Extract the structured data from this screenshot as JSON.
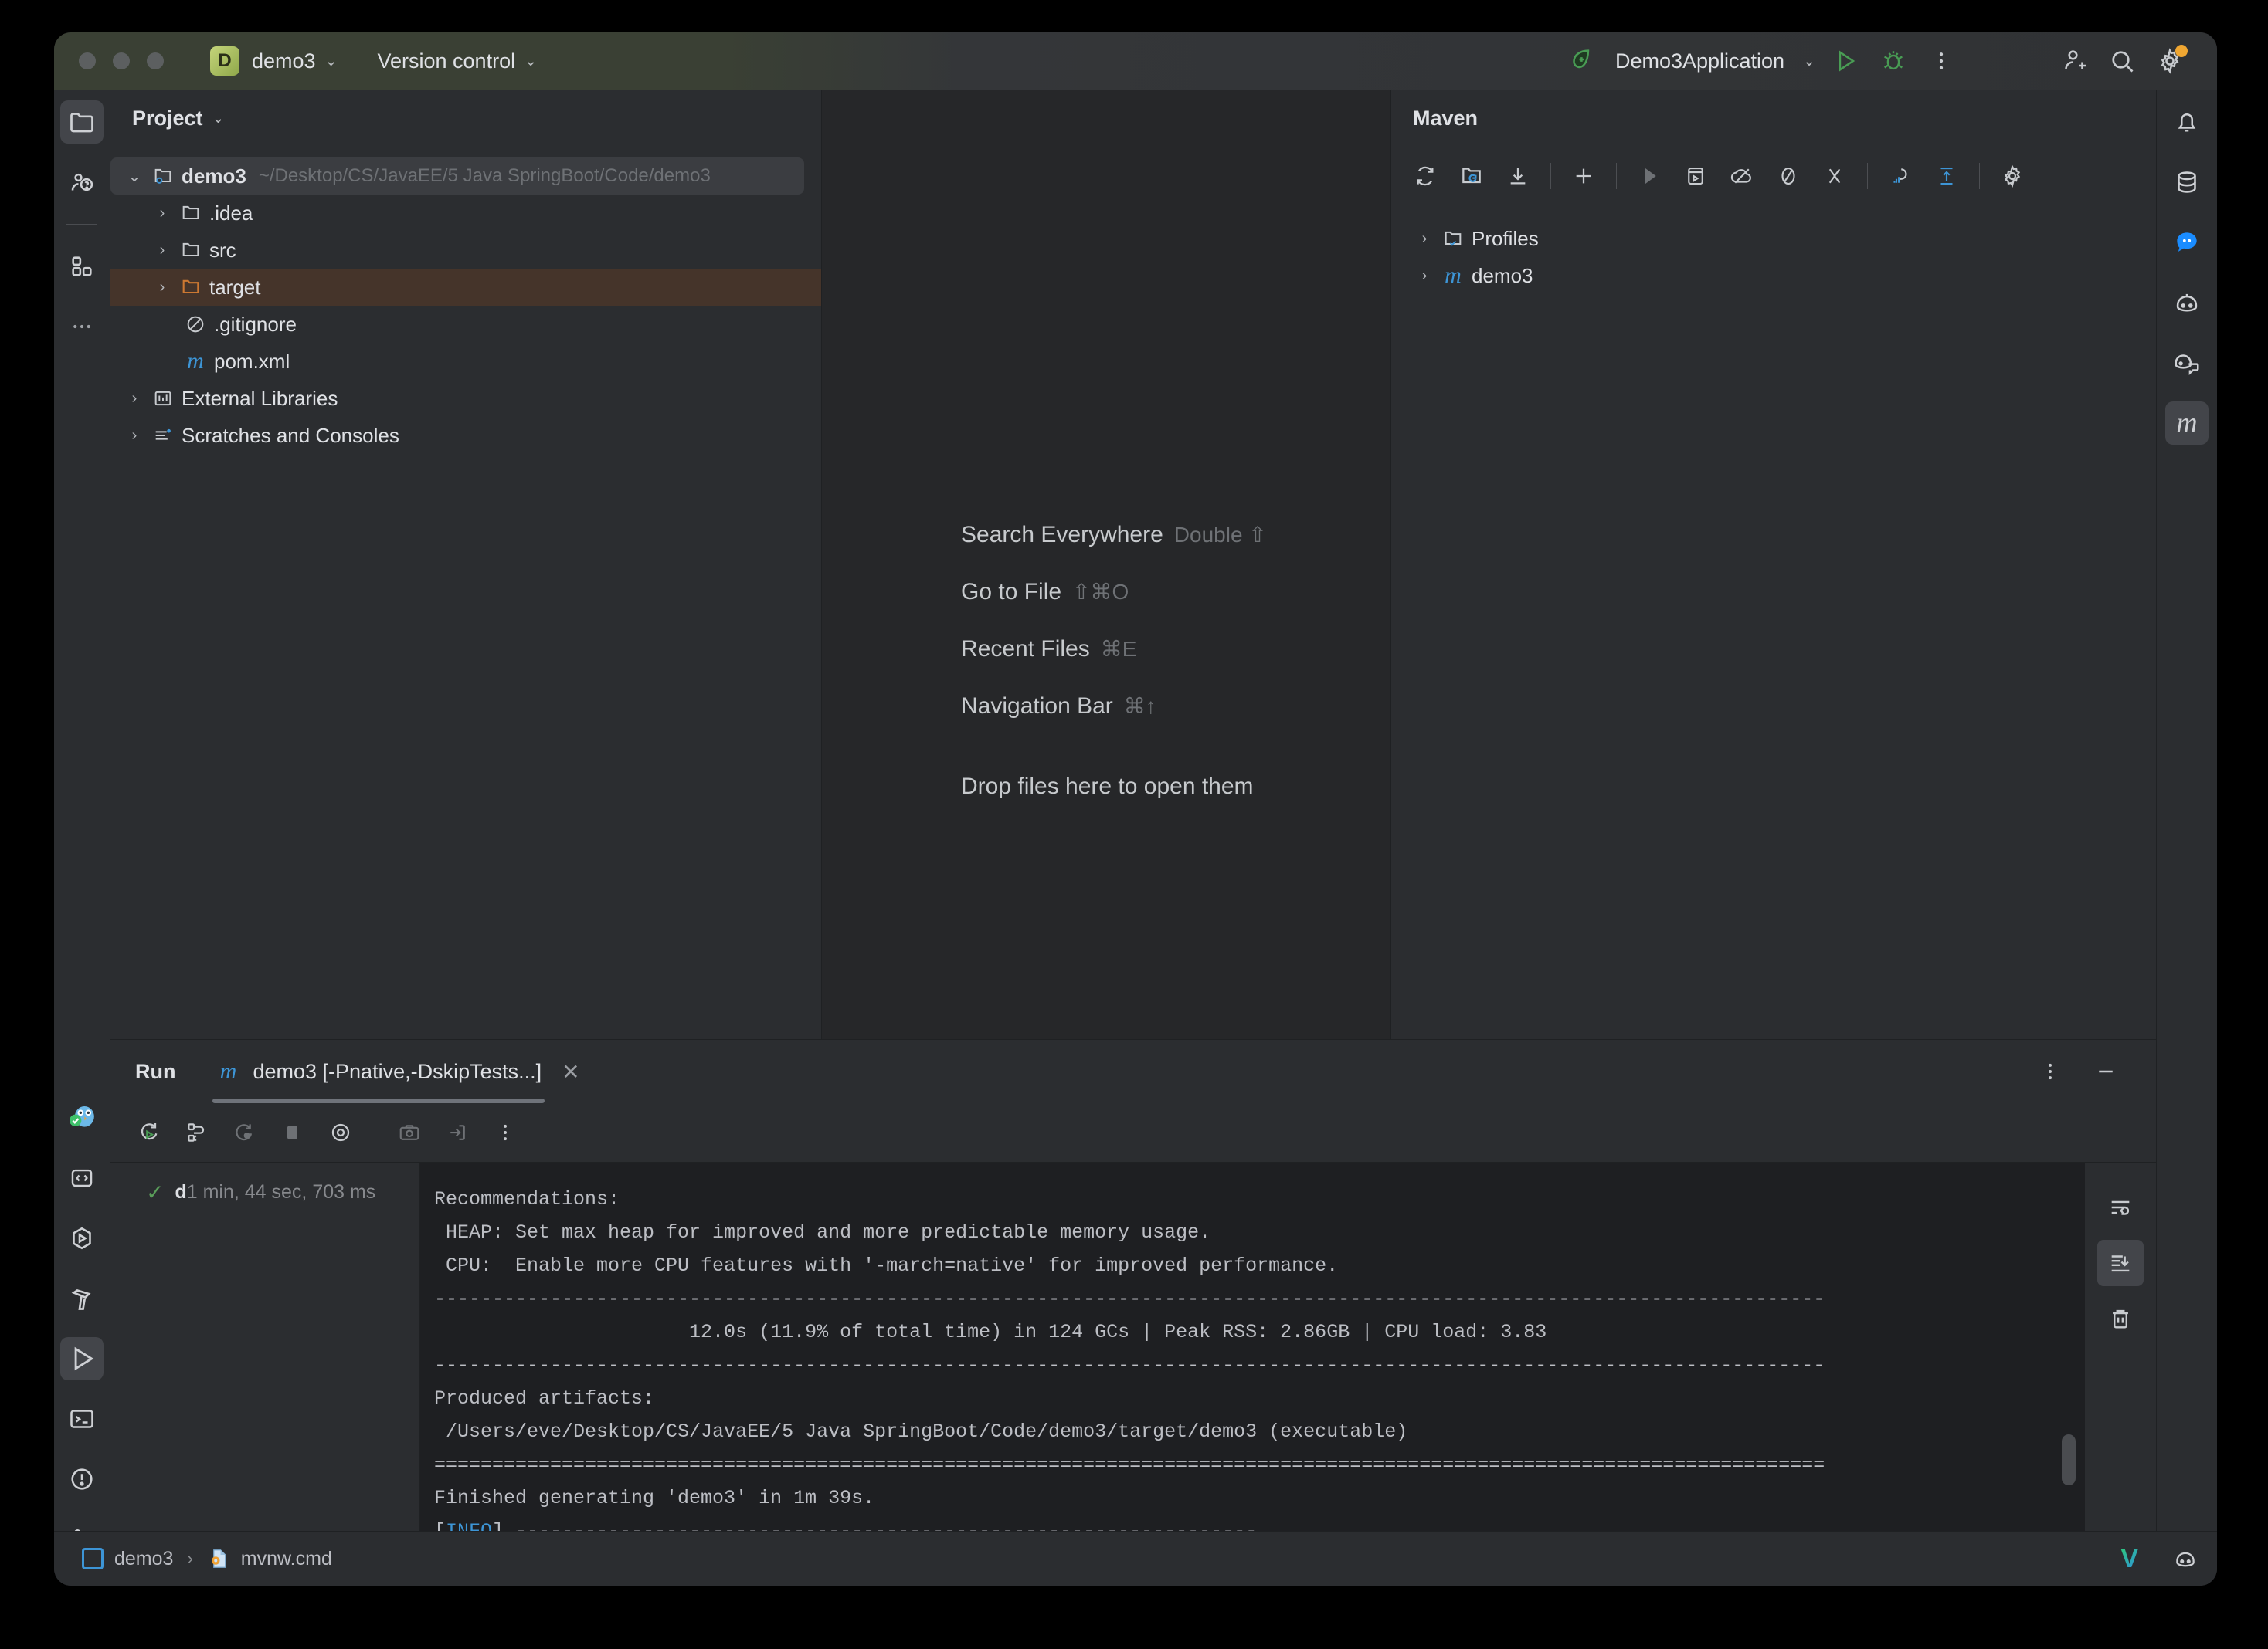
{
  "titlebar": {
    "project_badge": "D",
    "project_name": "demo3",
    "version_control": "Version control",
    "run_config": "Demo3Application",
    "chevron": "⌄"
  },
  "left_stripe": {
    "items": [
      {
        "name": "project",
        "icon": "folder-icon",
        "selected": true
      },
      {
        "name": "ai-assistant",
        "icon": "assistant-icon",
        "selected": false
      },
      {
        "name": "structure",
        "icon": "structure-icon",
        "selected": false
      },
      {
        "name": "more",
        "icon": "more-icon",
        "selected": false
      }
    ],
    "bottom_items": [
      {
        "name": "sonar",
        "icon": "owl-icon",
        "selected": false
      },
      {
        "name": "endpoints",
        "icon": "brackets-icon",
        "selected": false
      },
      {
        "name": "services",
        "icon": "services-icon",
        "selected": false
      },
      {
        "name": "build",
        "icon": "hammer-icon",
        "selected": false
      },
      {
        "name": "run",
        "icon": "play-icon",
        "selected": true
      },
      {
        "name": "terminal",
        "icon": "terminal-icon",
        "selected": false
      },
      {
        "name": "problems",
        "icon": "warning-icon",
        "selected": false
      },
      {
        "name": "git",
        "icon": "branch-icon",
        "selected": false
      }
    ]
  },
  "right_stripe": {
    "items": [
      {
        "name": "notifications",
        "icon": "bell-icon",
        "selected": false
      },
      {
        "name": "database",
        "icon": "database-icon",
        "selected": false
      },
      {
        "name": "ai-chat",
        "icon": "chat-bubble-icon",
        "selected": false
      },
      {
        "name": "copilot",
        "icon": "copilot-icon",
        "selected": false
      },
      {
        "name": "code-with-me",
        "icon": "code-with-me-icon",
        "selected": false
      },
      {
        "name": "maven",
        "icon": "maven-m-icon",
        "selected": true
      }
    ]
  },
  "project_panel": {
    "title": "Project",
    "chevron": "⌄",
    "tree": [
      {
        "label": "demo3",
        "path": "~/Desktop/CS/JavaEE/5 Java SpringBoot/Code/demo3",
        "icon": "module-icon",
        "arrow": "⌄",
        "indent": 0,
        "selected": true,
        "bold": true
      },
      {
        "label": ".idea",
        "path": "",
        "icon": "folder-icon",
        "arrow": "›",
        "indent": 1,
        "selected": false,
        "bold": false
      },
      {
        "label": "src",
        "path": "",
        "icon": "folder-icon",
        "arrow": "›",
        "indent": 1,
        "selected": false,
        "bold": false
      },
      {
        "label": "target",
        "path": "",
        "icon": "folder-orange-icon",
        "arrow": "›",
        "indent": 1,
        "selected": false,
        "bold": false
      },
      {
        "label": ".gitignore",
        "path": "",
        "icon": "gitignore-icon",
        "arrow": "",
        "indent": 1,
        "selected": false,
        "bold": false
      },
      {
        "label": "pom.xml",
        "path": "",
        "icon": "maven-m-icon",
        "arrow": "",
        "indent": 1,
        "selected": false,
        "bold": false
      },
      {
        "label": "External Libraries",
        "path": "",
        "icon": "libraries-icon",
        "arrow": "›",
        "indent": 0,
        "selected": false,
        "bold": false
      },
      {
        "label": "Scratches and Consoles",
        "path": "",
        "icon": "scratches-icon",
        "arrow": "›",
        "indent": 0,
        "selected": false,
        "bold": false
      }
    ]
  },
  "editor": {
    "hints": [
      {
        "label": "Search Everywhere",
        "key": "Double ⇧"
      },
      {
        "label": "Go to File",
        "key": "⇧⌘O"
      },
      {
        "label": "Recent Files",
        "key": "⌘E"
      },
      {
        "label": "Navigation Bar",
        "key": "⌘↑"
      }
    ],
    "drop_text": "Drop files here to open them"
  },
  "maven_panel": {
    "title": "Maven",
    "toolbar": [
      {
        "name": "reload-all-maven-projects",
        "icon": "reload-icon"
      },
      {
        "name": "reload-project",
        "icon": "reload-folder-icon"
      },
      {
        "name": "download-sources",
        "icon": "download-icon"
      },
      {
        "name": "add-maven-project",
        "icon": "plus-icon"
      },
      {
        "name": "run-maven-goal",
        "icon": "play-icon"
      },
      {
        "name": "execute-maven-goal",
        "icon": "terminal-run-icon"
      },
      {
        "name": "toggle-offline-mode",
        "icon": "offline-icon"
      },
      {
        "name": "skip-tests",
        "icon": "skip-tests-icon"
      },
      {
        "name": "collapse-all",
        "icon": "collapse-icon"
      },
      {
        "name": "show-dependencies",
        "icon": "dependencies-icon"
      },
      {
        "name": "expand-all",
        "icon": "expand-icon"
      },
      {
        "name": "maven-settings",
        "icon": "gear-icon"
      }
    ],
    "tree": [
      {
        "label": "Profiles",
        "icon": "profiles-folder-icon",
        "arrow": "›"
      },
      {
        "label": "demo3",
        "icon": "maven-m-icon",
        "arrow": "›"
      }
    ]
  },
  "run_window": {
    "title": "Run",
    "tab_label": "demo3 [-Pnative,-DskipTests...]",
    "tab_icon": "maven-m-icon",
    "close": "✕",
    "toolbar": [
      {
        "name": "rerun",
        "icon": "rerun-icon"
      },
      {
        "name": "rerun-failed",
        "icon": "rerun-failed-icon"
      },
      {
        "name": "restart",
        "icon": "restart-icon"
      },
      {
        "name": "stop",
        "icon": "stop-icon"
      },
      {
        "name": "filter-view",
        "icon": "eye-icon"
      },
      {
        "name": "screenshot",
        "icon": "camera-icon"
      },
      {
        "name": "export",
        "icon": "export-icon"
      },
      {
        "name": "more-options",
        "icon": "more-vertical-icon"
      }
    ],
    "header_actions": [
      {
        "name": "options-menu",
        "icon": "more-vertical-icon"
      },
      {
        "name": "hide-tool-window",
        "icon": "minimize-icon"
      }
    ],
    "tree_node": {
      "status": "✓",
      "name": "d",
      "duration": "1 min, 44 sec, 703 ms"
    },
    "console_side": [
      {
        "name": "soft-wrap",
        "icon": "soft-wrap-icon",
        "selected": false
      },
      {
        "name": "scroll-to-end",
        "icon": "scroll-to-end-icon",
        "selected": true
      },
      {
        "name": "clear-all",
        "icon": "trash-icon",
        "selected": false
      }
    ],
    "console_lines": [
      {
        "text": "Recommendations:",
        "type": "plain"
      },
      {
        "text": " HEAP: Set max heap for improved and more predictable memory usage.",
        "type": "plain"
      },
      {
        "text": " CPU:  Enable more CPU features with '-march=native' for improved performance.",
        "type": "plain"
      },
      {
        "text": "------------------------------------------------------------------------------------------------------------------------",
        "type": "plain"
      },
      {
        "text": "                      12.0s (11.9% of total time) in 124 GCs | Peak RSS: 2.86GB | CPU load: 3.83",
        "type": "plain"
      },
      {
        "text": "------------------------------------------------------------------------------------------------------------------------",
        "type": "plain"
      },
      {
        "text": "Produced artifacts:",
        "type": "plain"
      },
      {
        "text": " /Users/eve/Desktop/CS/JavaEE/5 Java SpringBoot/Code/demo3/target/demo3 (executable)",
        "type": "plain"
      },
      {
        "text": "========================================================================================================================",
        "type": "plain"
      },
      {
        "text": "Finished generating 'demo3' in 1m 39s.",
        "type": "plain"
      },
      {
        "text": "[INFO] ----------------------------------------------------------------",
        "type": "info",
        "prefix": "[",
        "tag": "INFO",
        "suffix": "] ----------------------------------------------------------------"
      }
    ]
  },
  "statusbar": {
    "module": "demo3",
    "chevron": "›",
    "file": "mvnw.cmd",
    "right_items": [
      {
        "name": "vite-logo",
        "icon": "v-logo-icon",
        "label": "V"
      },
      {
        "name": "copilot-status",
        "icon": "copilot-icon"
      }
    ]
  },
  "colors": {
    "accent_blue": "#3d95d6",
    "run_green": "#499c54",
    "target_highlight": "#45342a",
    "titlebar_green": "#3a4034",
    "panel_bg": "#2b2d30",
    "editor_bg": "#262729",
    "console_bg": "#1e1f22"
  }
}
